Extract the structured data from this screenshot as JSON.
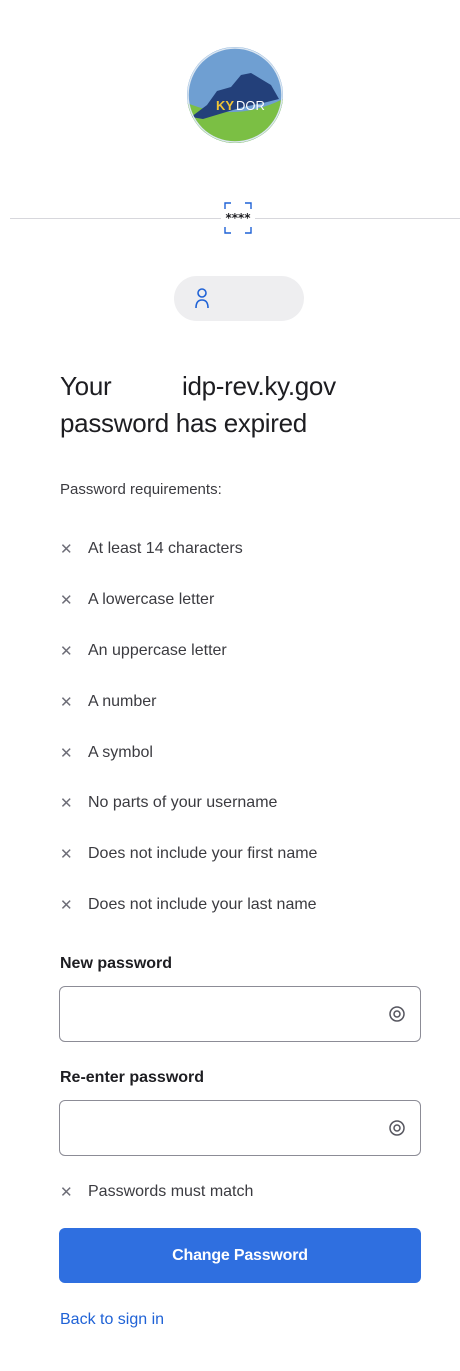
{
  "logo": {
    "text_ky": "KY",
    "text_dor": "DOR",
    "colors": {
      "sky": "#5d8fc6",
      "state": "#23407a",
      "grass": "#7bbf44"
    }
  },
  "divider_icon": "password-field-icon",
  "user_chip": {
    "icon": "user-icon"
  },
  "heading": {
    "line1_prefix": "Your",
    "domain": "idp-rev.ky.gov",
    "line2": "password has expired"
  },
  "requirements": {
    "title": "Password requirements:",
    "items": [
      "At least 14 characters",
      "A lowercase letter",
      "An uppercase letter",
      "A number",
      "A symbol",
      "No parts of your username",
      "Does not include your first name",
      "Does not include your last name"
    ]
  },
  "new_password": {
    "label": "New password",
    "value": "",
    "placeholder": ""
  },
  "reenter_password": {
    "label": "Re-enter password",
    "value": "",
    "placeholder": ""
  },
  "match_requirement": "Passwords must match",
  "submit_label": "Change Password",
  "back_link": "Back to sign in",
  "colors": {
    "primary": "#2f6fe0",
    "link": "#1f62d6",
    "text": "#1d1d21"
  }
}
